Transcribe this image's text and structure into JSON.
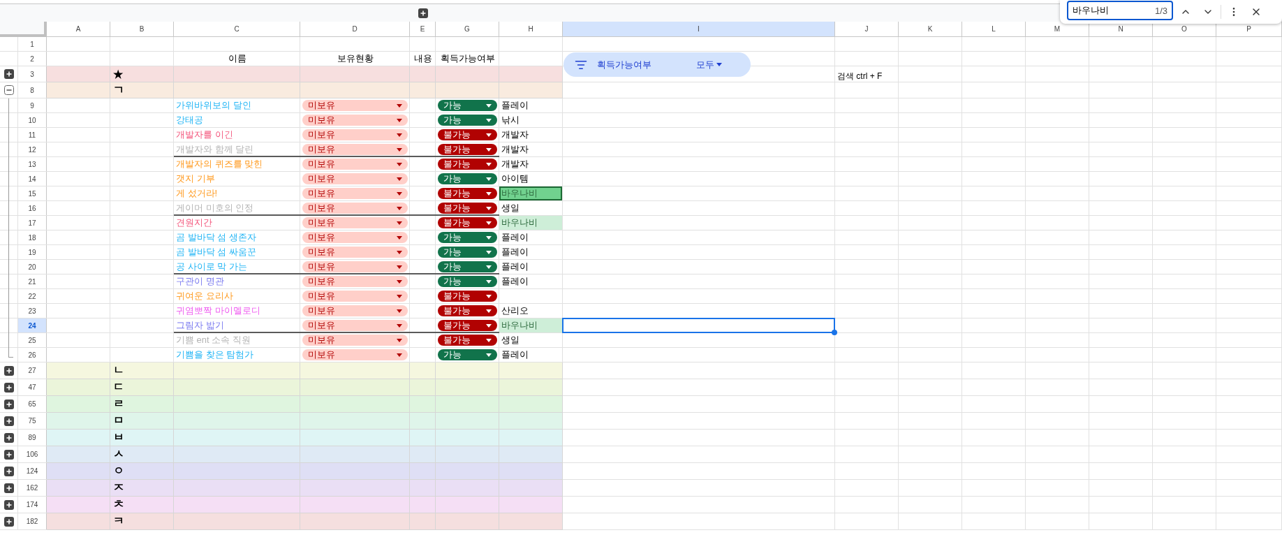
{
  "find_bar": {
    "query": "바우나비",
    "count": "1/3"
  },
  "filter": {
    "label": "획득가능여부",
    "value": "모두"
  },
  "sheet": {
    "columns": [
      {
        "label": "A",
        "selected": false
      },
      {
        "label": "B",
        "selected": false
      },
      {
        "label": "C",
        "selected": false
      },
      {
        "label": "D",
        "selected": false
      },
      {
        "label": "E",
        "selected": false
      },
      {
        "label": "G",
        "selected": false
      },
      {
        "label": "H",
        "selected": false
      },
      {
        "label": "I",
        "selected": true
      },
      {
        "label": "J",
        "selected": false
      },
      {
        "label": "K",
        "selected": false
      },
      {
        "label": "L",
        "selected": false
      },
      {
        "label": "M",
        "selected": false
      },
      {
        "label": "N",
        "selected": false
      },
      {
        "label": "O",
        "selected": false
      },
      {
        "label": "P",
        "selected": false
      }
    ],
    "rows": [
      {
        "kind": "blank",
        "number": "1"
      },
      {
        "kind": "header",
        "number": "2",
        "name": "이름",
        "status": "보유현황",
        "content": "내용",
        "availability": "획득가능여부"
      }
    ],
    "groups": [
      {
        "number": "3",
        "label": "★",
        "color": "#f7dfdf",
        "expanded": false,
        "aside": "검색 ctrl + F"
      },
      {
        "number": "8",
        "label": "ㄱ",
        "color": "#f9ebdf",
        "expanded": true,
        "children": [
          {
            "number": "9",
            "name": "가위바위보의 달인",
            "color": "#22b5f5",
            "status": "미보유",
            "availability": "가능",
            "available": true,
            "note": "플레이",
            "found": false,
            "current": false,
            "divider_below": false,
            "selected": false
          },
          {
            "number": "10",
            "name": "강태공",
            "color": "#22b5f5",
            "status": "미보유",
            "availability": "가능",
            "available": true,
            "note": "낚시",
            "found": false,
            "current": false,
            "divider_below": false,
            "selected": false
          },
          {
            "number": "11",
            "name": "개발자를 이긴",
            "color": "#f4587e",
            "status": "미보유",
            "availability": "불가능",
            "available": false,
            "note": "개발자",
            "found": false,
            "current": false,
            "divider_below": false,
            "selected": false
          },
          {
            "number": "12",
            "name": "개발자와 함께 달린",
            "color": "#b4b4b4",
            "status": "미보유",
            "availability": "불가능",
            "available": false,
            "note": "개발자",
            "found": false,
            "current": false,
            "divider_below": true,
            "selected": false
          },
          {
            "number": "13",
            "name": "개발자의 퀴즈를 맞힌",
            "color": "#ff9b21",
            "status": "미보유",
            "availability": "불가능",
            "available": false,
            "note": "개발자",
            "found": false,
            "current": false,
            "divider_below": false,
            "selected": false
          },
          {
            "number": "14",
            "name": "갯지 기부",
            "color": "#ff9b21",
            "status": "미보유",
            "availability": "가능",
            "available": true,
            "note": "아이템",
            "found": false,
            "current": false,
            "divider_below": false,
            "selected": false
          },
          {
            "number": "15",
            "name": "게 섰거라!",
            "color": "#ff9b21",
            "status": "미보유",
            "availability": "불가능",
            "available": false,
            "note": "바우나비",
            "found": true,
            "current": true,
            "divider_below": false,
            "selected": false
          },
          {
            "number": "16",
            "name": "게이머 미호의 인정",
            "color": "#b4b4b4",
            "status": "미보유",
            "availability": "불가능",
            "available": false,
            "note": "생일",
            "found": false,
            "current": false,
            "divider_below": true,
            "selected": false
          },
          {
            "number": "17",
            "name": "견원지간",
            "color": "#f4587e",
            "status": "미보유",
            "availability": "불가능",
            "available": false,
            "note": "바우나비",
            "found": true,
            "current": false,
            "divider_below": false,
            "selected": false
          },
          {
            "number": "18",
            "name": "곰 발바닥 섬 생존자",
            "color": "#22b5f5",
            "status": "미보유",
            "availability": "가능",
            "available": true,
            "note": "플레이",
            "found": false,
            "current": false,
            "divider_below": false,
            "selected": false
          },
          {
            "number": "19",
            "name": "곰 발바닥 섬 싸움꾼",
            "color": "#22b5f5",
            "status": "미보유",
            "availability": "가능",
            "available": true,
            "note": "플레이",
            "found": false,
            "current": false,
            "divider_below": false,
            "selected": false
          },
          {
            "number": "20",
            "name": "공 사이로 막 가는",
            "color": "#22b5f5",
            "status": "미보유",
            "availability": "가능",
            "available": true,
            "note": "플레이",
            "found": false,
            "current": false,
            "divider_below": true,
            "selected": false
          },
          {
            "number": "21",
            "name": "구관이 명관",
            "color": "#7c7cf0",
            "status": "미보유",
            "availability": "가능",
            "available": true,
            "note": "플레이",
            "found": false,
            "current": false,
            "divider_below": false,
            "selected": false
          },
          {
            "number": "22",
            "name": "귀여운 요리사",
            "color": "#ff9b21",
            "status": "미보유",
            "availability": "불가능",
            "available": false,
            "divider_below": false,
            "selected": false
          },
          {
            "number": "23",
            "name": "귀염뽀짝 마이멜로디",
            "color": "#ef5ef0",
            "status": "미보유",
            "availability": "불가능",
            "available": false,
            "note": "산리오",
            "found": false,
            "current": false,
            "divider_below": false,
            "selected": false
          },
          {
            "number": "24",
            "name": "그림자 밟기",
            "color": "#7c7cf0",
            "status": "미보유",
            "availability": "불가능",
            "available": false,
            "note": "바우나비",
            "found": true,
            "current": false,
            "divider_below": true,
            "selected": true
          },
          {
            "number": "25",
            "name": "기쁨 ent 소속 직원",
            "color": "#b4b4b4",
            "status": "미보유",
            "availability": "불가능",
            "available": false,
            "note": "생일",
            "found": false,
            "current": false,
            "divider_below": false,
            "selected": false
          },
          {
            "number": "26",
            "name": "기쁨을 찾은 탐험가",
            "color": "#22b5f5",
            "status": "미보유",
            "availability": "가능",
            "available": true,
            "note": "플레이",
            "found": false,
            "current": false,
            "divider_below": false,
            "selected": false
          }
        ]
      },
      {
        "number": "27",
        "label": "ㄴ",
        "color": "#f5f7df",
        "expanded": false
      },
      {
        "number": "47",
        "label": "ㄷ",
        "color": "#ebf5da",
        "expanded": false
      },
      {
        "number": "65",
        "label": "ㄹ",
        "color": "#dff5df",
        "expanded": false
      },
      {
        "number": "75",
        "label": "ㅁ",
        "color": "#dff5ea",
        "expanded": false
      },
      {
        "number": "89",
        "label": "ㅂ",
        "color": "#dff5f5",
        "expanded": false
      },
      {
        "number": "106",
        "label": "ㅅ",
        "color": "#dfeaf5",
        "expanded": false
      },
      {
        "number": "124",
        "label": "ㅇ",
        "color": "#dfdff5",
        "expanded": false
      },
      {
        "number": "162",
        "label": "ㅈ",
        "color": "#eadff5",
        "expanded": false
      },
      {
        "number": "174",
        "label": "ㅊ",
        "color": "#f5dff5",
        "expanded": false
      },
      {
        "number": "182",
        "label": "ㅋ",
        "color": "#f5dfdf",
        "expanded": false
      }
    ]
  }
}
